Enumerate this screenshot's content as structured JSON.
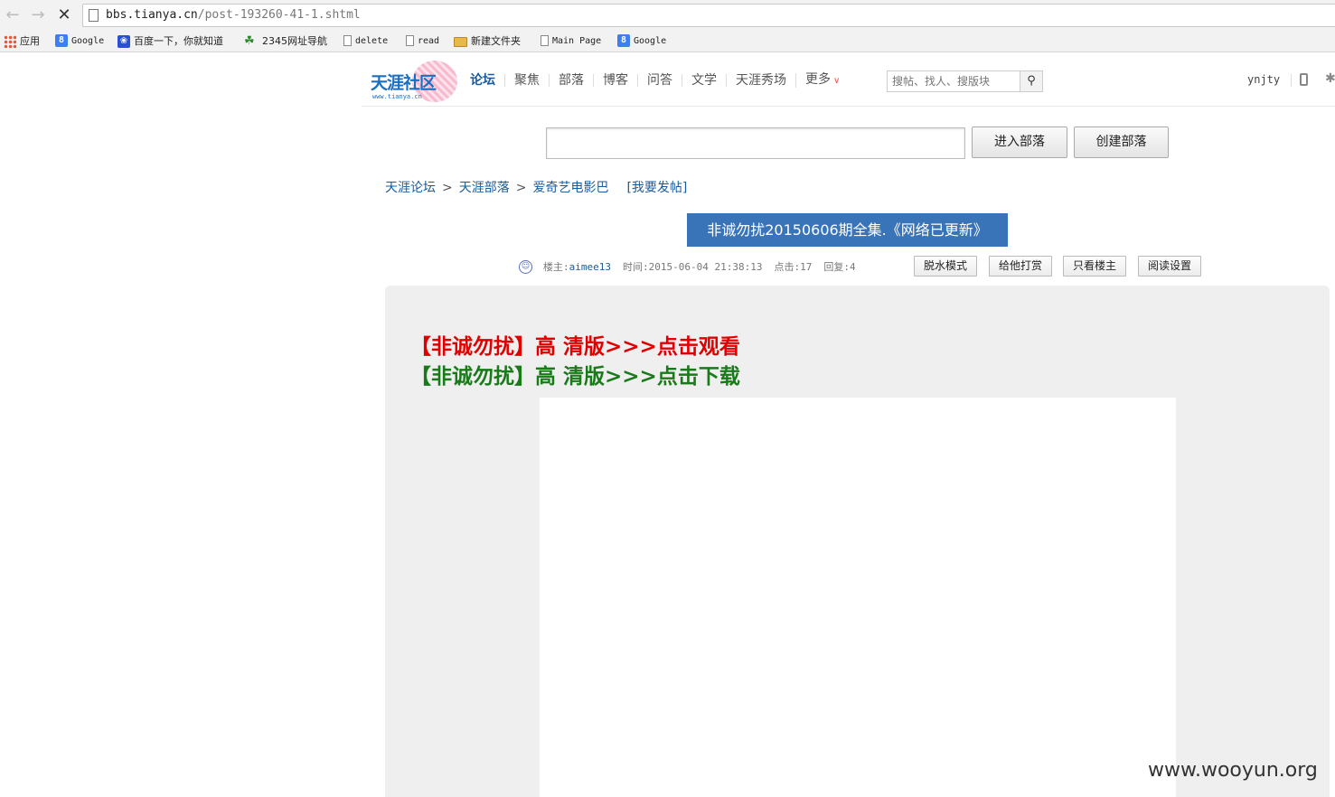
{
  "browser": {
    "url_host": "bbs.tianya.cn",
    "url_path": "/post-193260-41-1.shtml"
  },
  "bookmarks": [
    {
      "label": "应用",
      "icon": "apps-grid-icon"
    },
    {
      "label": "Google",
      "icon": "google-icon"
    },
    {
      "label": "百度一下，你就知道",
      "icon": "baidu-paw-icon"
    },
    {
      "label": "2345网址导航",
      "icon": "leaf-icon"
    },
    {
      "label": "delete",
      "icon": "page-icon"
    },
    {
      "label": "read",
      "icon": "page-icon"
    },
    {
      "label": "新建文件夹",
      "icon": "folder-icon"
    },
    {
      "label": "Main Page",
      "icon": "page-icon"
    },
    {
      "label": "Google",
      "icon": "google-icon"
    }
  ],
  "header": {
    "logo_text": "天涯社区",
    "logo_sub": "www.tianya.cn",
    "nav": [
      "论坛",
      "聚焦",
      "部落",
      "博客",
      "问答",
      "文学",
      "天涯秀场",
      "更多"
    ],
    "search_placeholder": "搜帖、找人、搜版块",
    "username": "ynjty"
  },
  "tribe": {
    "enter_label": "进入部落",
    "create_label": "创建部落"
  },
  "breadcrumb": {
    "items": [
      "天涯论坛",
      "天涯部落",
      "爱奇艺电影巴"
    ],
    "post_link": "[我要发帖]"
  },
  "post": {
    "title": "非诚勿扰20150606期全集.《网络已更新》",
    "author_label": "楼主:",
    "author": "aimee13",
    "time_label": "时间:",
    "time": "2015-06-04 21:38:13",
    "clicks_label": "点击:",
    "clicks": "17",
    "replies_label": "回复:",
    "replies": "4",
    "buttons": [
      "脱水模式",
      "给他打赏",
      "只看楼主",
      "阅读设置"
    ],
    "line_watch": "【非诚勿扰】高 清版>>>点击观看",
    "line_download": "【非诚勿扰】高 清版>>>点击下载",
    "line_watch_color": "#e00000",
    "line_download_color": "#1a7a1a"
  },
  "watermark": "www.wooyun.org"
}
